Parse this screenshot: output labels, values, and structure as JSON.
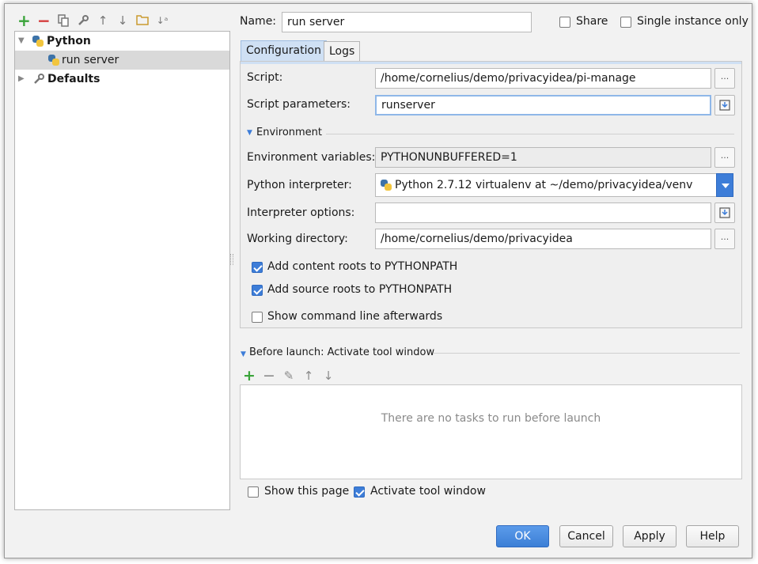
{
  "toolbar": {
    "icons": [
      "add-icon",
      "remove-icon",
      "copy-icon",
      "wrench-icon",
      "move-up-icon",
      "move-down-icon",
      "folder-icon",
      "sort-icon"
    ]
  },
  "tree": {
    "python_label": "Python",
    "run_server_label": "run server",
    "defaults_label": "Defaults"
  },
  "header": {
    "name_label": "Name:",
    "name_value": "run server",
    "share_label": "Share",
    "share_checked": false,
    "single_instance_label": "Single instance only",
    "single_instance_checked": false
  },
  "tabs": [
    {
      "label": "Configuration",
      "active": true
    },
    {
      "label": "Logs",
      "active": false
    }
  ],
  "config": {
    "script_label": "Script:",
    "script_value": "/home/cornelius/demo/privacyidea/pi-manage",
    "script_params_label": "Script parameters:",
    "script_params_value": "runserver",
    "environment_title": "Environment",
    "env_vars_label": "Environment variables:",
    "env_vars_value": "PYTHONUNBUFFERED=1",
    "interpreter_label": "Python interpreter:",
    "interpreter_value": "Python 2.7.12 virtualenv at ~/demo/privacyidea/venv",
    "interpreter_options_label": "Interpreter options:",
    "interpreter_options_value": "",
    "working_dir_label": "Working directory:",
    "working_dir_value": "/home/cornelius/demo/privacyidea",
    "content_roots_label": "Add content roots to PYTHONPATH",
    "content_roots_checked": true,
    "source_roots_label": "Add source roots to PYTHONPATH",
    "source_roots_checked": true,
    "show_cmd_label": "Show command line afterwards",
    "show_cmd_checked": false,
    "ellipsis": "..."
  },
  "before_launch": {
    "title": "Before launch: Activate tool window",
    "empty_text": "There are no tasks to run before launch",
    "show_page_label": "Show this page",
    "show_page_checked": false,
    "activate_label": "Activate tool window",
    "activate_checked": true
  },
  "buttons": {
    "ok": "OK",
    "cancel": "Cancel",
    "apply": "Apply",
    "help": "Help"
  },
  "colors": {
    "accent": "#3d7dd8",
    "add_green": "#3aa43a",
    "remove_red": "#d43a3a"
  }
}
